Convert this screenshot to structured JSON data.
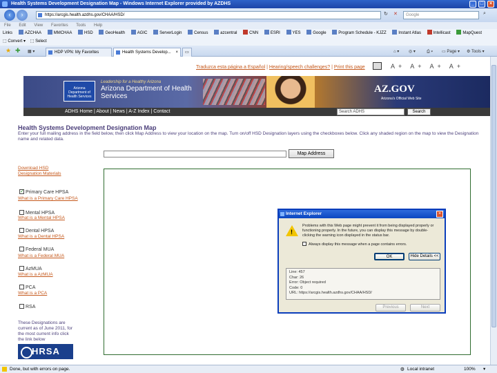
{
  "window": {
    "title": "Health Systems Development Designation Map - Windows Internet Explorer provided by AZDHS"
  },
  "address_bar": {
    "url": "https://arcgis.health.azdhs.gov/CHAA/HSD/",
    "search_placeholder": "Google"
  },
  "menu": [
    "File",
    "Edit",
    "View",
    "Favorites",
    "Tools",
    "Help"
  ],
  "links_bar": {
    "label": "Links",
    "items": [
      "AZCHAA",
      "MMCHAA",
      "HSD",
      "GeoHealth",
      "AGIC",
      "ServerLogin",
      "Census",
      "azcentral",
      "CNN",
      "ESRI",
      "YES",
      "Google",
      "Program Schedule - KJZZ",
      "Instant Atlas",
      "Intellicast",
      "MapQuest"
    ]
  },
  "fav_bar": {
    "convert": "Convert",
    "select": "Select"
  },
  "tabs": [
    {
      "label": "HDP VPN: My Favorites",
      "active": false
    },
    {
      "label": "Health Systems Develop...",
      "active": true
    }
  ],
  "command_bar": {
    "page": "Page",
    "tools": "Tools"
  },
  "page": {
    "top_links": [
      "Traduzca esta página a Español",
      "Hearing/speech challenges?",
      "Print this page"
    ],
    "font_sizes": "A+ A+ A+ A+",
    "banner": {
      "tagline": "Leadership for a Healthy Arizona",
      "agency": "Arizona Department of Health Services",
      "logo_text": "Arizona Department of Health Services",
      "azgov": "AZ.GOV",
      "azgov_sub": "Arizona's Official Web Site"
    },
    "nav": "ADHS Home | About | News | A-Z Index | Contact",
    "site_search": {
      "value": "Search ADHS",
      "button": "Search"
    },
    "title": "Health Systems Development Designation Map",
    "instructions": "Enter your full mailing address in the field below, then click Map Address to view your location on the map. Turn on/off HSD Designation layers using the checkboxes below. Click any shaded region on the map to view the Designation name and related data.",
    "map_address_button": "Map Address",
    "download_link": "Download HSD Designation Materials",
    "layers": [
      {
        "label": "Primary Care HPSA",
        "checked": true,
        "link": "What is a Primary Care HPSA"
      },
      {
        "label": "Mental HPSA",
        "checked": false,
        "link": "What is a Mental HPSA"
      },
      {
        "label": "Dental HPSA",
        "checked": false,
        "link": "What is a Dental HPSA"
      },
      {
        "label": "Federal MUA",
        "checked": false,
        "link": "What is a Federal MUA"
      },
      {
        "label": "AzMUA",
        "checked": false,
        "link": "What is a AzMUA"
      },
      {
        "label": "PCA",
        "checked": false,
        "link": "What is a PCA"
      },
      {
        "label": "RSA",
        "checked": false,
        "link": ""
      }
    ],
    "designation_note": "These Designations are current as of June 2011, for the most current info click the link below",
    "hrsa": "HRSA"
  },
  "dialog": {
    "title": "Internet Explorer",
    "message": "Problems with this Web page might prevent it from being displayed properly or functioning properly. In the future, you can display this message by double-clicking the warning icon displayed in the status bar.",
    "checkbox": "Always display this message when a page contains errors.",
    "ok": "OK",
    "hide_details": "Hide Details <<",
    "details": [
      "Line: 457",
      "Char: 26",
      "Error: Object required",
      "Code: 0",
      "URL: https://arcgis.health.azdhs.gov/CHAA/HSD/"
    ],
    "previous": "Previous",
    "next": "Next"
  },
  "status_bar": {
    "text": "Done, but with errors on page.",
    "zone": "Local intranet",
    "zoom": "100%"
  }
}
